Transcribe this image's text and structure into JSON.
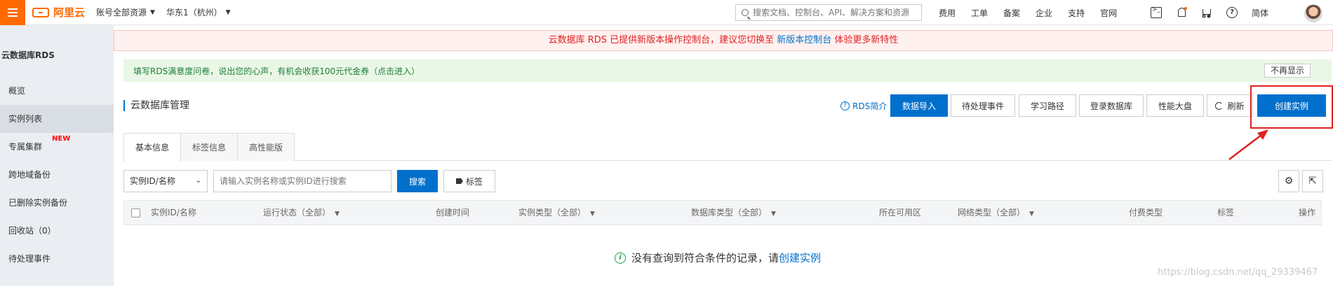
{
  "topbar": {
    "logo_text": "阿里云",
    "account_scope": "账号全部资源",
    "region": "华东1（杭州）",
    "search_placeholder": "搜索文档、控制台、API、解决方案和资源",
    "links": [
      "费用",
      "工单",
      "备案",
      "企业",
      "支持",
      "官网"
    ],
    "language": "简体",
    "accent_color": "#ff6a00"
  },
  "sidebar": {
    "title": "云数据库RDS",
    "items": [
      {
        "label": "概览"
      },
      {
        "label": "实例列表"
      },
      {
        "label": "专属集群",
        "badge": "NEW"
      },
      {
        "label": "跨地域备份"
      },
      {
        "label": "已删除实例备份"
      },
      {
        "label": "回收站（0）"
      },
      {
        "label": "待处理事件"
      }
    ]
  },
  "notice": {
    "prefix": "云数据库 RDS 已提供新版本操作控制台，建议您切换至",
    "link": "新版本控制台",
    "suffix": "体验更多新特性"
  },
  "survey": {
    "text": "填写RDS满意度问卷，说出您的心声，有机会收获100元代金券（点击进入）",
    "close": "不再显示"
  },
  "page": {
    "title": "云数据库管理",
    "intro_link": "RDS简介",
    "buttons": {
      "import": "数据导入",
      "events": "待处理事件",
      "learning": "学习路径",
      "login": "登录数据库",
      "dashboard": "性能大盘",
      "refresh": "刷新",
      "create": "创建实例"
    }
  },
  "tabs": [
    "基本信息",
    "标签信息",
    "高性能版"
  ],
  "filter": {
    "field": "实例ID/名称",
    "placeholder": "请输入实例名称或实例ID进行搜索",
    "search": "搜索",
    "tag": "标签"
  },
  "table": {
    "columns": [
      "实例ID/名称",
      "运行状态（全部）",
      "创建时间",
      "实例类型（全部）",
      "数据库类型（全部）",
      "所在可用区",
      "网络类型（全部）",
      "付费类型",
      "标签",
      "操作"
    ]
  },
  "empty": {
    "text": "没有查询到符合条件的记录，请",
    "link": "创建实例"
  },
  "watermark": "https://blog.csdn.net/qq_29339467"
}
